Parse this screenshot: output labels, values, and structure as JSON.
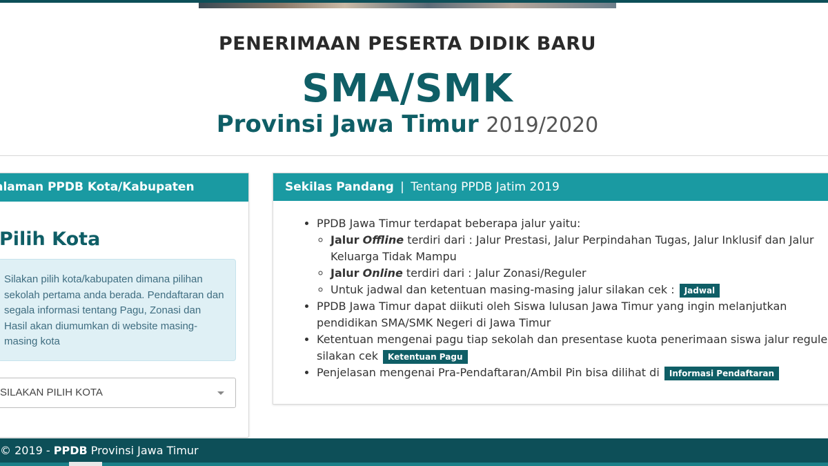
{
  "header": {
    "line1": "PENERIMAAN PESERTA DIDIK BARU",
    "line2": "SMA/SMK",
    "line3_bold": "Provinsi Jawa Timur",
    "line3_year": "2019/2020"
  },
  "left_panel": {
    "heading": "alaman PPDB Kota/Kabupaten",
    "title": "Pilih Kota",
    "info": "Silakan pilih kota/kabupaten dimana pilihan sekolah pertama anda berada. Pendaftaran dan segala informasi tentang Pagu, Zonasi dan Hasil akan diumumkan di website masing-masing kota",
    "select_value": "SILAKAN PILIH KOTA"
  },
  "right_panel": {
    "heading_bold": "Sekilas Pandang",
    "heading_sep": "|",
    "heading_sub": "Tentang PPDB Jatim 2019",
    "item1": "PPDB Jawa Timur terdapat beberapa jalur yaitu:",
    "sub1_bold": "Jalur",
    "sub1_italic": "Offline",
    "sub1_text": "terdiri dari : Jalur Prestasi, Jalur Perpindahan Tugas, Jalur Inklusif dan Jalur Keluarga Tidak Mampu",
    "sub2_bold": "Jalur",
    "sub2_italic": "Online",
    "sub2_text": "terdiri dari : Jalur Zonasi/Reguler",
    "sub3_text": "Untuk jadwal dan ketentuan masing-masing jalur silakan cek :",
    "sub3_badge": "Jadwal",
    "item2": "PPDB Jawa Timur dapat diikuti oleh Siswa lulusan Jawa Timur yang ingin melanjutkan pendidikan SMA/SMK Negeri di Jawa Timur",
    "item3": "Ketentuan mengenai pagu tiap sekolah dan presentase kuota penerimaan siswa jalur reguler silakan cek",
    "item3_badge": "Ketentuan Pagu",
    "item4": "Penjelasan mengenai Pra-Pendaftaran/Ambil Pin bisa dilihat di",
    "item4_badge": "Informasi Pendaftaran"
  },
  "footer": {
    "prefix": "© 2019 -",
    "brand": "PPDB",
    "suffix": "Provinsi Jawa Timur"
  },
  "colors": {
    "accent": "#1a9aa2",
    "dark": "#0f5e66",
    "footer": "#0d4f58",
    "info_bg": "#dff0f5"
  }
}
